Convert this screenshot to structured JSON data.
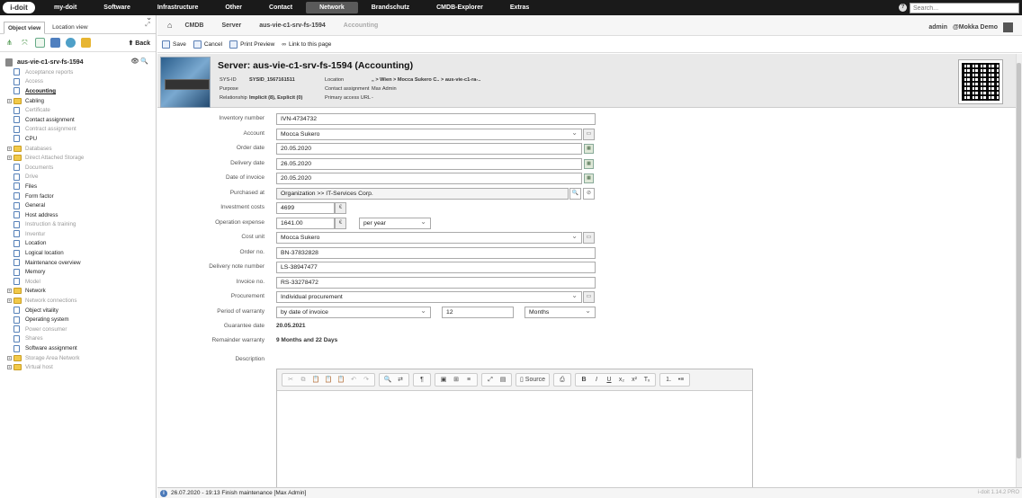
{
  "topbar": {
    "logo": "i-doit",
    "menu": [
      "my-doit",
      "Software",
      "Infrastructure",
      "Other",
      "Contact",
      "Network",
      "Brandschutz",
      "CMDB-Explorer",
      "Extras"
    ],
    "active_menu": "Network",
    "search_placeholder": "Search..."
  },
  "sidebar": {
    "tabs": [
      "Object view",
      "Location view"
    ],
    "back_label": "Back",
    "root": "aus-vie-c1-srv-fs-1594",
    "items": [
      {
        "label": "Acceptance reports",
        "state": "dim",
        "expand": false,
        "icon": "page"
      },
      {
        "label": "Access",
        "state": "dim",
        "expand": false,
        "icon": "page"
      },
      {
        "label": "Accounting",
        "state": "sel",
        "expand": false,
        "icon": "page"
      },
      {
        "label": "Cabling",
        "state": "on",
        "expand": true,
        "icon": "folder"
      },
      {
        "label": "Certificate",
        "state": "dim",
        "expand": false,
        "icon": "page"
      },
      {
        "label": "Contact assignment",
        "state": "on",
        "expand": false,
        "icon": "page"
      },
      {
        "label": "Contract assignment",
        "state": "dim",
        "expand": false,
        "icon": "page"
      },
      {
        "label": "CPU",
        "state": "on",
        "expand": false,
        "icon": "page"
      },
      {
        "label": "Databases",
        "state": "dim",
        "expand": true,
        "icon": "folder"
      },
      {
        "label": "Direct Attached Storage",
        "state": "dim",
        "expand": true,
        "icon": "folder"
      },
      {
        "label": "Documents",
        "state": "dim",
        "expand": false,
        "icon": "page"
      },
      {
        "label": "Drive",
        "state": "dim",
        "expand": false,
        "icon": "page"
      },
      {
        "label": "Files",
        "state": "on",
        "expand": false,
        "icon": "page"
      },
      {
        "label": "Form factor",
        "state": "on",
        "expand": false,
        "icon": "page"
      },
      {
        "label": "General",
        "state": "on",
        "expand": false,
        "icon": "page"
      },
      {
        "label": "Host address",
        "state": "on",
        "expand": false,
        "icon": "page"
      },
      {
        "label": "Instruction & training",
        "state": "dim",
        "expand": false,
        "icon": "page"
      },
      {
        "label": "Inventur",
        "state": "dim",
        "expand": false,
        "icon": "page"
      },
      {
        "label": "Location",
        "state": "on",
        "expand": false,
        "icon": "page"
      },
      {
        "label": "Logical location",
        "state": "on",
        "expand": false,
        "icon": "page"
      },
      {
        "label": "Maintenance overview",
        "state": "on",
        "expand": false,
        "icon": "page"
      },
      {
        "label": "Memory",
        "state": "on",
        "expand": false,
        "icon": "page"
      },
      {
        "label": "Model",
        "state": "dim",
        "expand": false,
        "icon": "page"
      },
      {
        "label": "Network",
        "state": "on",
        "expand": true,
        "icon": "folder"
      },
      {
        "label": "Network connections",
        "state": "dim",
        "expand": true,
        "icon": "folder"
      },
      {
        "label": "Object vitality",
        "state": "on",
        "expand": false,
        "icon": "page"
      },
      {
        "label": "Operating system",
        "state": "on",
        "expand": false,
        "icon": "page"
      },
      {
        "label": "Power consumer",
        "state": "dim",
        "expand": false,
        "icon": "page"
      },
      {
        "label": "Shares",
        "state": "dim",
        "expand": false,
        "icon": "page"
      },
      {
        "label": "Software assignment",
        "state": "on",
        "expand": false,
        "icon": "page"
      },
      {
        "label": "Storage Area Network",
        "state": "dim",
        "expand": true,
        "icon": "folder"
      },
      {
        "label": "Virtual host",
        "state": "dim",
        "expand": true,
        "icon": "folder"
      }
    ]
  },
  "breadcrumb": [
    "CMDB",
    "Server",
    "aus-vie-c1-srv-fs-1594",
    "Accounting"
  ],
  "user": {
    "name": "admin",
    "tenant": "@Mokka Demo"
  },
  "actions": [
    "Save",
    "Cancel",
    "Print Preview",
    "Link to this page"
  ],
  "header": {
    "title": "Server: aus-vie-c1-srv-fs-1594 (Accounting)",
    "sysid_label": "SYS-ID",
    "sysid": "SYSID_1567161511",
    "purpose_label": "Purpose",
    "purpose": "",
    "relationship_label": "Relationship",
    "relationship": "Implicit (8), Explicit (0)",
    "location_label": "Location",
    "location": "„ > Wien > Mocca Sukero C.. > aus-vie-c1-ra-..",
    "contact_label": "Contact assignment",
    "contact": "Max Admin",
    "url_label": "Primary access URL",
    "url": "-"
  },
  "form": {
    "inventory_number": {
      "label": "Inventory number",
      "value": "IVN-4734732"
    },
    "account": {
      "label": "Account",
      "value": "Mocca Sukero"
    },
    "order_date": {
      "label": "Order date",
      "value": "20.05.2020"
    },
    "delivery_date": {
      "label": "Delivery date",
      "value": "26.05.2020"
    },
    "invoice_date": {
      "label": "Date of invoice",
      "value": "20.05.2020"
    },
    "purchased_at": {
      "label": "Purchased at",
      "value": "Organization >> IT-Services Corp."
    },
    "investment_costs": {
      "label": "Investment costs",
      "value": "4699",
      "currency": "€"
    },
    "operation_expense": {
      "label": "Operation expense",
      "value": "1641.00",
      "currency": "€",
      "period": "per year"
    },
    "cost_unit": {
      "label": "Cost unit",
      "value": "Mocca Sukero"
    },
    "order_no": {
      "label": "Order no.",
      "value": "BN-37832828"
    },
    "delivery_note": {
      "label": "Delivery note number",
      "value": "LS-38947477"
    },
    "invoice_no": {
      "label": "Invoice no.",
      "value": "RS-33278472"
    },
    "procurement": {
      "label": "Procurement",
      "value": "Individual procurement"
    },
    "warranty": {
      "label": "Period of warranty",
      "basis": "by date of invoice",
      "amount": "12",
      "unit": "Months"
    },
    "guarantee_date": {
      "label": "Guarantee date",
      "value": "20.05.2021"
    },
    "remainder": {
      "label": "Remainder warranty",
      "value": "9 Months and 22 Days"
    },
    "description": {
      "label": "Description",
      "source_label": "Source"
    }
  },
  "status": {
    "message": "26.07.2020 - 19:13 Finish maintenance [Max Admin]",
    "version": "i-doit 1.14.2 PRO"
  }
}
